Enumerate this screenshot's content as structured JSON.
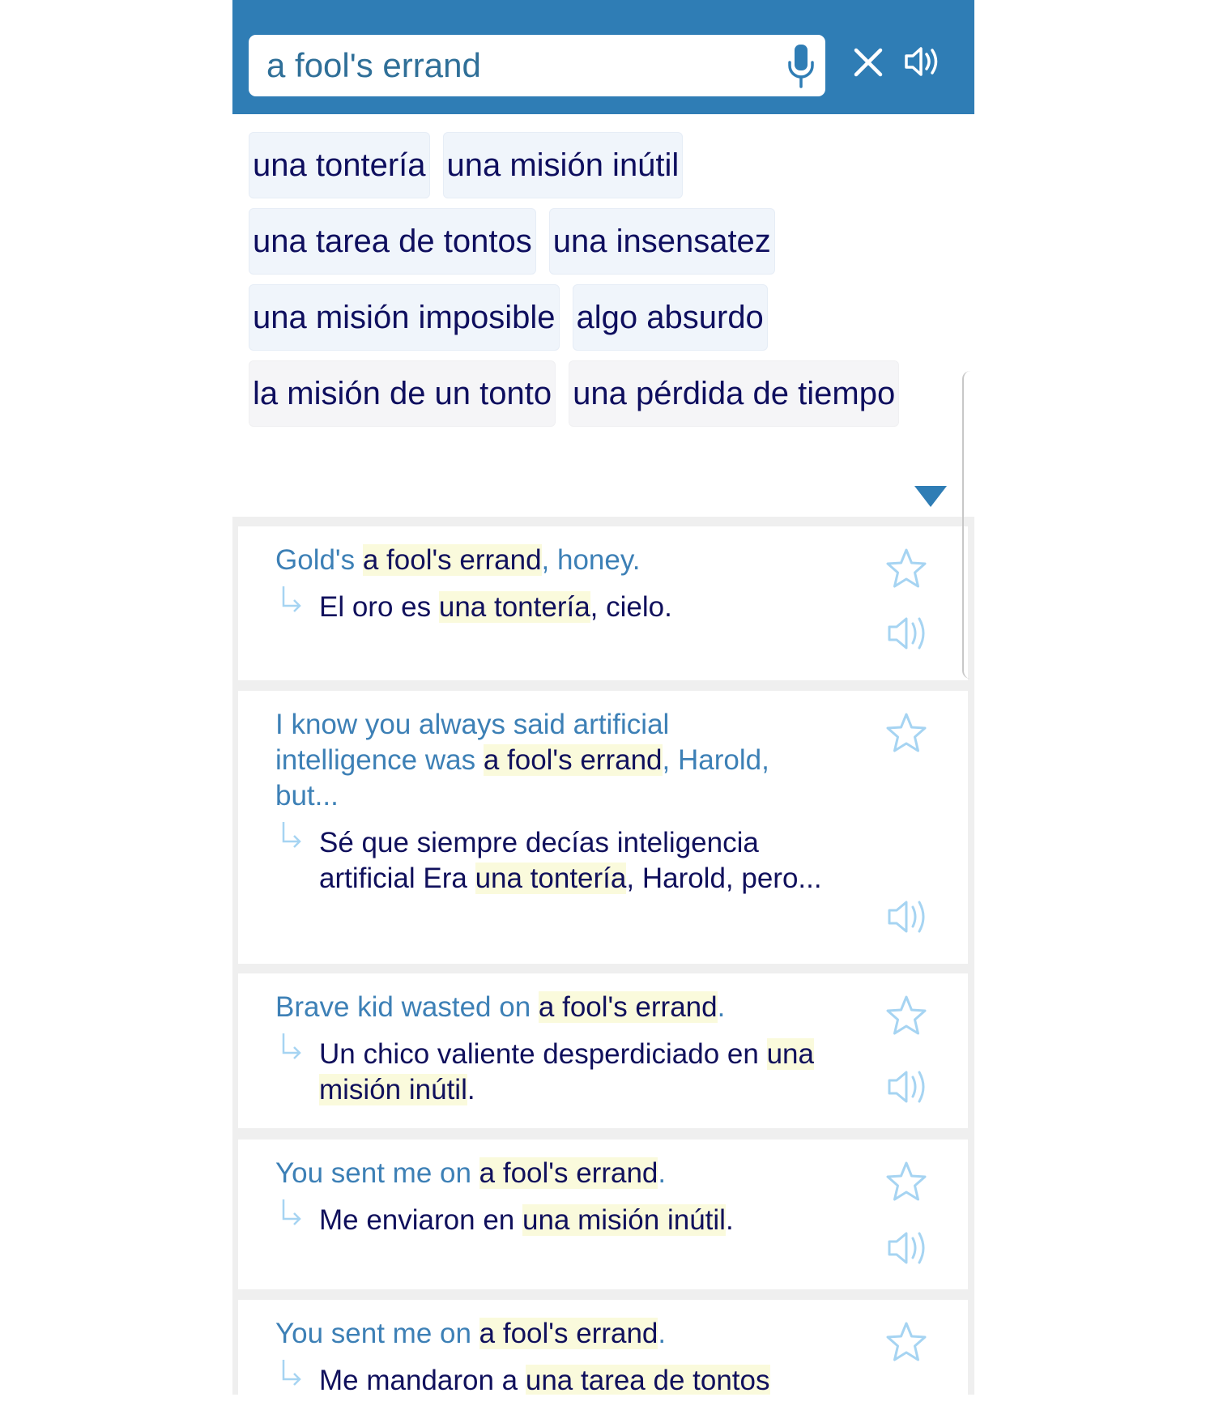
{
  "colors": {
    "brand": "#2f7db5",
    "source_text": "#3d80b6",
    "target_text": "#10105c",
    "highlight": "#fafadc",
    "icon_light": "#a6d4f2"
  },
  "search": {
    "query": "a fool's errand",
    "mic_icon": "microphone-icon",
    "clear_icon": "close-icon",
    "speak_icon": "speaker-icon"
  },
  "translations": {
    "rows": [
      [
        "una tontería",
        "una misión inútil"
      ],
      [
        "una tarea de tontos",
        "una insensatez"
      ],
      [
        "una misión imposible",
        "algo absurdo"
      ],
      [
        "la misión de un tonto",
        "una pérdida de tiempo"
      ]
    ],
    "expand_icon": "triangle-down-icon"
  },
  "examples": [
    {
      "source": [
        {
          "t": "Gold's ",
          "h": false
        },
        {
          "t": "a fool's errand",
          "h": true
        },
        {
          "t": ", honey.",
          "h": false
        }
      ],
      "target": [
        {
          "t": "El oro es ",
          "h": false
        },
        {
          "t": "una tontería",
          "h": true
        },
        {
          "t": ", cielo.",
          "h": false
        }
      ]
    },
    {
      "source": [
        {
          "t": "I know you always said artificial intelligence was ",
          "h": false
        },
        {
          "t": "a fool's errand",
          "h": true
        },
        {
          "t": ", Harold, but...",
          "h": false
        }
      ],
      "target": [
        {
          "t": "Sé que siempre decías inteligencia artificial Era ",
          "h": false
        },
        {
          "t": "una tontería",
          "h": true
        },
        {
          "t": ", Harold, pero...",
          "h": false
        }
      ]
    },
    {
      "source": [
        {
          "t": "Brave kid wasted on ",
          "h": false
        },
        {
          "t": "a fool's errand",
          "h": true
        },
        {
          "t": ".",
          "h": false
        }
      ],
      "target": [
        {
          "t": "Un chico valiente desperdiciado en ",
          "h": false
        },
        {
          "t": "una misión inútil",
          "h": true
        },
        {
          "t": ".",
          "h": false
        }
      ]
    },
    {
      "source": [
        {
          "t": "You sent me on ",
          "h": false
        },
        {
          "t": "a fool's errand",
          "h": true
        },
        {
          "t": ".",
          "h": false
        }
      ],
      "target": [
        {
          "t": "Me enviaron en ",
          "h": false
        },
        {
          "t": "una misión inútil",
          "h": true
        },
        {
          "t": ".",
          "h": false
        }
      ]
    },
    {
      "source": [
        {
          "t": "You sent me on ",
          "h": false
        },
        {
          "t": "a fool's errand",
          "h": true
        },
        {
          "t": ".",
          "h": false
        }
      ],
      "target": [
        {
          "t": "Me mandaron a ",
          "h": false
        },
        {
          "t": "una tarea de tontos",
          "h": true
        }
      ]
    }
  ]
}
